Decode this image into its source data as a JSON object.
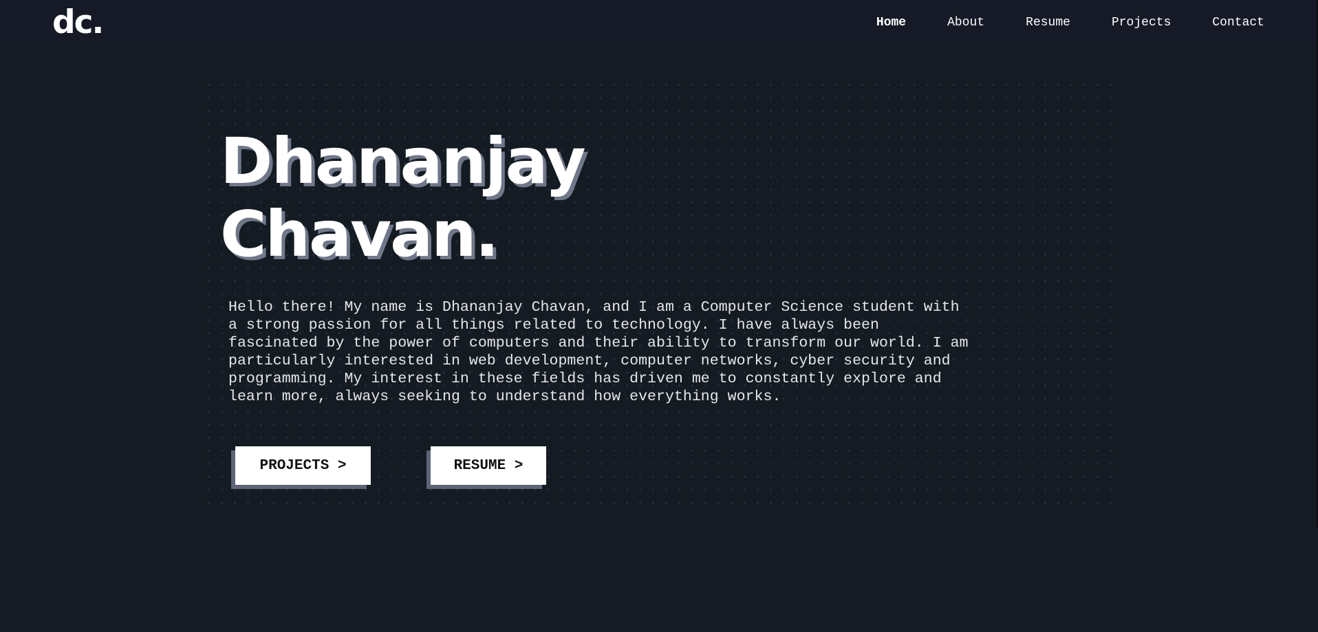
{
  "navbar": {
    "logo": "dc.",
    "links": [
      {
        "label": "Home",
        "active": true
      },
      {
        "label": "About",
        "active": false
      },
      {
        "label": "Resume",
        "active": false
      },
      {
        "label": "Projects",
        "active": false
      },
      {
        "label": "Contact",
        "active": false
      }
    ]
  },
  "hero": {
    "name_line1": "Dhananjay",
    "name_line2": "Chavan.",
    "bio": "Hello there! My name is Dhananjay Chavan, and I am a Computer Science student with\na strong passion for all things related to technology. I have always been\nfascinated by the power of computers and their ability to transform our world. I am\nparticularly interested in web development, computer networks, cyber security and\nprogramming. My interest in these fields has driven me to constantly explore and\nlearn more, always seeking to understand how everything works.",
    "buttons": {
      "projects_label": "PROJECTS >",
      "resume_label": "RESUME >"
    }
  },
  "colors": {
    "background": "#141b22",
    "navbar": "#161a26",
    "text": "#ffffff",
    "name_shadow": "#707789",
    "button_shadow": "#5f6478"
  }
}
